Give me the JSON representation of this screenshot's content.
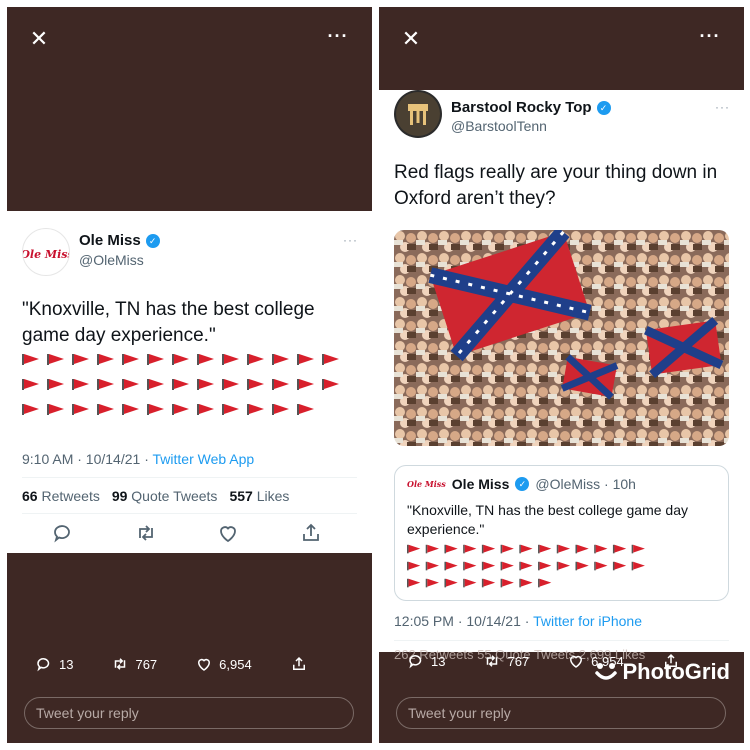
{
  "left": {
    "tweet": {
      "name": "Ole Miss",
      "handle": "@OleMiss",
      "logo_text": "Ole Miss",
      "text": "\"Knoxville, TN has the best college game day experience.\"",
      "flags_rows": [
        13,
        13,
        12
      ],
      "time": "9:10 AM · 10/14/21 · ",
      "source": "Twitter Web App",
      "retweets": "66",
      "retweets_label": "Retweets",
      "quotes": "99",
      "quotes_label": "Quote Tweets",
      "likes": "557",
      "likes_label": "Likes"
    },
    "bottom": {
      "replies": "13",
      "retweets": "767",
      "likes": "6,954"
    },
    "reply_placeholder": "Tweet your reply"
  },
  "right": {
    "tweet": {
      "name": "Barstool Rocky Top",
      "handle": "@BarstoolTenn",
      "text": "Red flags really are your thing down in Oxford aren’t they?",
      "time": "12:05 PM · 10/14/21 · ",
      "source": "Twitter for iPhone",
      "stats_text": "262 Retweets  55 Quote Tweets  2,699 Likes"
    },
    "quote": {
      "logo_text": "Ole Miss",
      "name": "Ole Miss",
      "handle_time": "@OleMiss · 10h",
      "text": "\"Knoxville, TN has the best college game day experience.\"",
      "flags_rows": [
        13,
        13,
        8
      ]
    },
    "bottom": {
      "replies": "13",
      "retweets": "767",
      "likes": "6,954"
    },
    "reply_placeholder": "Tweet your reply",
    "watermark": "PhotoGrid"
  },
  "colors": {
    "panel_bg": "#3e2824",
    "flag": "#d8202c",
    "link": "#1d9bf0",
    "verified": "#1d9bf0"
  }
}
